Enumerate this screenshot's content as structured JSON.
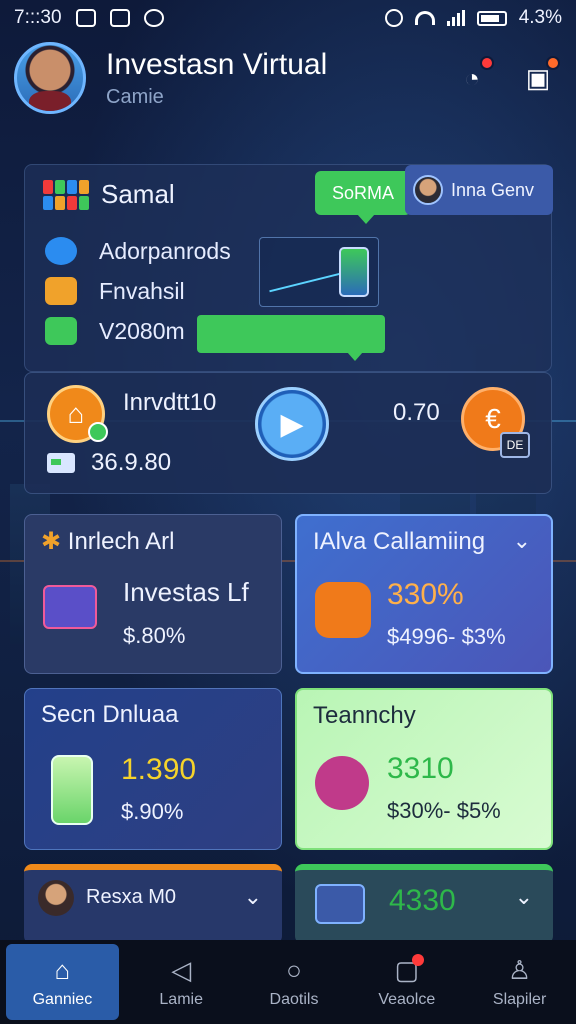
{
  "status_bar": {
    "time": "7:::30",
    "battery": "4.3%"
  },
  "header": {
    "title": "Investasn Virtual",
    "subtitle": "Camie"
  },
  "top_card": {
    "title": "Samal",
    "green_pill": "SoRMA",
    "user_chip": "Inna Genv",
    "items": [
      {
        "label": "Adorpanrods",
        "icon": "chat-bubble-icon",
        "color": "#2b8cf0"
      },
      {
        "label": "Fnvahsil",
        "icon": "mail-icon",
        "color": "#f0a22b"
      },
      {
        "label": "V2080m",
        "icon": "tag-icon",
        "color": "#3ec85a"
      }
    ]
  },
  "mid_card": {
    "label": "Inrvdtt10",
    "amount": "36.9.80",
    "value": "0.70",
    "tag": "DE"
  },
  "tiles": [
    {
      "title": "Inrlech Arl",
      "big": "Investas Lf",
      "small": "$.80%",
      "accent": "#f0a22b"
    },
    {
      "title": "IAlva Callamiing",
      "big": "330%",
      "small": "$4996-  $3%",
      "accent": "#f07a1a"
    },
    {
      "title": "Secn Dnluaa",
      "big": "1.390",
      "small": "$.90%",
      "accent": "#f5d32b"
    },
    {
      "title": "Teannchy",
      "big": "3310",
      "small": "$30%-  $5%",
      "accent": "#2eb84a"
    },
    {
      "title": "Resxa M0"
    },
    {
      "title": "4330"
    }
  ],
  "bottom_nav": [
    {
      "label": "Ganniec",
      "icon": "home-icon",
      "glyph": "⌂"
    },
    {
      "label": "Lamie",
      "icon": "back-triangle-icon",
      "glyph": "◁"
    },
    {
      "label": "Daotils",
      "icon": "circle-icon",
      "glyph": "○"
    },
    {
      "label": "Veaolce",
      "icon": "message-icon",
      "glyph": "▢"
    },
    {
      "label": "Slapiler",
      "icon": "person-icon",
      "glyph": "♙"
    }
  ]
}
